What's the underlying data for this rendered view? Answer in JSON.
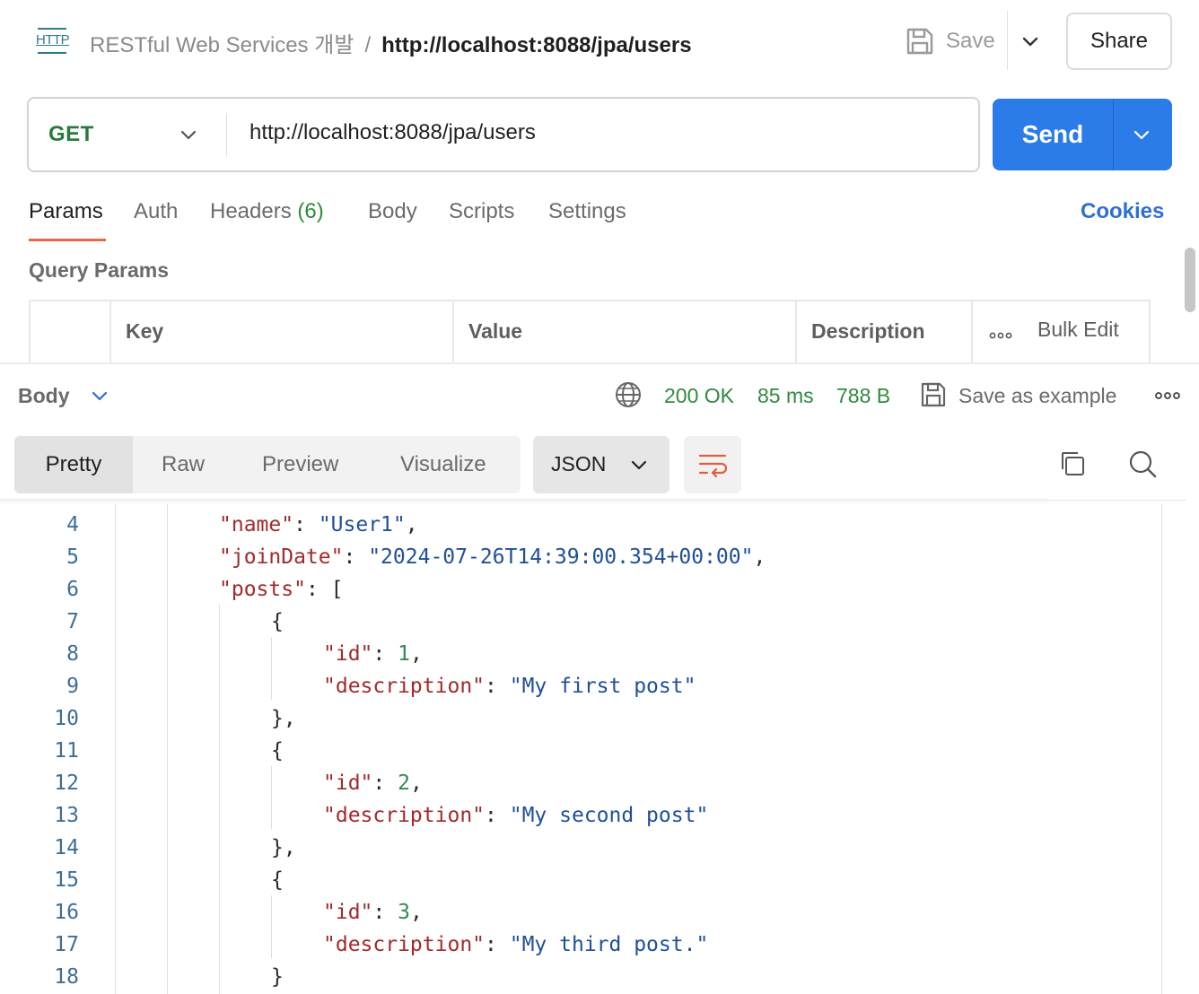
{
  "header": {
    "collection": "RESTful Web Services 개발",
    "separator": "/",
    "request_name": "http://localhost:8088/jpa/users",
    "http_icon_text": "HTTP",
    "save_label": "Save",
    "share_label": "Share"
  },
  "request": {
    "method": "GET",
    "url": "http://localhost:8088/jpa/users",
    "send_label": "Send"
  },
  "request_tabs": {
    "params": "Params",
    "auth": "Auth",
    "headers": "Headers",
    "headers_count": "(6)",
    "body": "Body",
    "scripts": "Scripts",
    "settings": "Settings",
    "cookies": "Cookies",
    "active": "Params"
  },
  "query_params": {
    "title": "Query Params",
    "columns": [
      "Key",
      "Value",
      "Description"
    ],
    "bulk_edit": "Bulk Edit"
  },
  "response": {
    "body_label": "Body",
    "status": "200 OK",
    "time": "85 ms",
    "size": "788 B",
    "save_example": "Save as example",
    "view_tabs": [
      "Pretty",
      "Raw",
      "Preview",
      "Visualize"
    ],
    "active_view": "Pretty",
    "format": "JSON"
  },
  "code_lines": [
    {
      "n": "4",
      "text": "\"name\": \"User1\","
    },
    {
      "n": "5",
      "text": "\"joinDate\": \"2024-07-26T14:39:00.354+00:00\","
    },
    {
      "n": "6",
      "text": "\"posts\": ["
    },
    {
      "n": "7",
      "text": "{"
    },
    {
      "n": "8",
      "text": "\"id\": 1,"
    },
    {
      "n": "9",
      "text": "\"description\": \"My first post\""
    },
    {
      "n": "10",
      "text": "},"
    },
    {
      "n": "11",
      "text": "{"
    },
    {
      "n": "12",
      "text": "\"id\": 2,"
    },
    {
      "n": "13",
      "text": "\"description\": \"My second post\""
    },
    {
      "n": "14",
      "text": "},"
    },
    {
      "n": "15",
      "text": "{"
    },
    {
      "n": "16",
      "text": "\"id\": 3,"
    },
    {
      "n": "17",
      "text": "\"description\": \"My third post.\""
    },
    {
      "n": "18",
      "text": "}"
    }
  ],
  "icons": {
    "http": "http-request-icon",
    "save": "floppy-disk-icon",
    "chevron": "chevron-down-icon",
    "globe": "globe-icon",
    "more": "more-dots-icon",
    "wrap": "word-wrap-icon",
    "copy": "copy-icon",
    "search": "search-icon"
  },
  "colors": {
    "send": "#2b7be8",
    "method": "#287a3c",
    "status": "#2f8a3e",
    "active_tab_underline": "#e8693c",
    "cookies": "#2f6fd0",
    "json_key": "#a22a2a",
    "json_string": "#1f4f9a",
    "json_number": "#2f8a57"
  }
}
